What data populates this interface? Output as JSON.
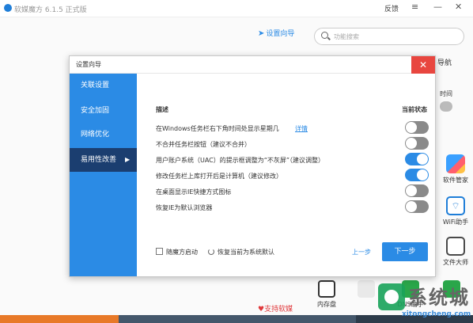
{
  "app": {
    "title": "软媒魔方 6.1.5 正式版",
    "feedback": "反馈",
    "menu_icon": "≡",
    "minimize_icon": "—",
    "close_icon": "✕",
    "wizard_link": "设置向导",
    "search_placeholder": "功能搜索",
    "nav_fragment": "导航",
    "time_fragment": "时间",
    "side_tools": [
      {
        "label": "软件管家",
        "icon": "software-manager-icon"
      },
      {
        "label": "WiFi助手",
        "icon": "wifi-icon"
      },
      {
        "label": "文件大师",
        "icon": "file-master-icon"
      }
    ],
    "bottom_tools": [
      {
        "label": "内存盘",
        "icon": "memory-disk-icon"
      },
      {
        "label": "DNS助手",
        "icon": "dns-icon"
      }
    ],
    "support_link": "支持软媒"
  },
  "dialog": {
    "title": "设置向导",
    "close_icon": "✕",
    "sidebar": [
      {
        "label": "关联设置"
      },
      {
        "label": "安全加固"
      },
      {
        "label": "网络优化"
      },
      {
        "label": "易用性改善",
        "active": true
      }
    ],
    "columns": {
      "description": "描述",
      "status": "当前状态"
    },
    "options": [
      {
        "label": "在Windows任务栏右下角时间处显示星期几",
        "link": "详情",
        "enabled": false
      },
      {
        "label": "不合并任务栏按钮（建议不合并）",
        "enabled": false
      },
      {
        "label": "用户账户系统（UAC）的提示框调整为“不灰屏”（建议调整）",
        "enabled": true
      },
      {
        "label": "修改任务栏上库打开后是计算机（建议修改）",
        "enabled": true
      },
      {
        "label": "在桌面显示IE快捷方式图标",
        "enabled": false
      },
      {
        "label": "恢复IE为默认浏览器",
        "enabled": false
      }
    ],
    "footer": {
      "autostart_label": "随魔方启动",
      "restore_label": "恢复当前为系统默认",
      "prev_label": "上一步",
      "next_label": "下一步"
    }
  },
  "watermark": {
    "name": "系统城",
    "domain": "xitongcheng.com"
  },
  "colors": {
    "accent": "#2b8be5",
    "sidebar_active": "#1b3e70",
    "close_red": "#e8463f",
    "toggle_off": "#8a8a8a"
  }
}
